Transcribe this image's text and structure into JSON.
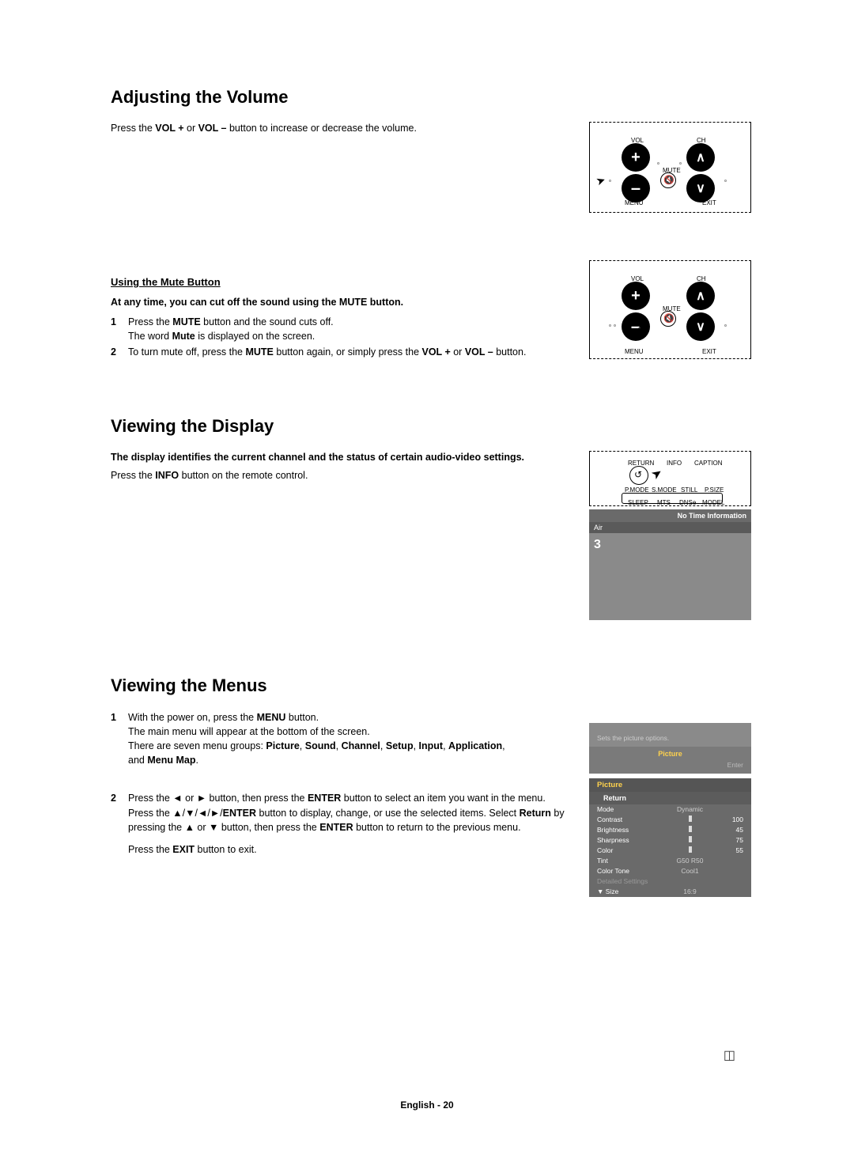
{
  "section1": {
    "heading": "Adjusting the Volume",
    "intro_a": "Press the ",
    "intro_b": "VOL +",
    "intro_c": " or ",
    "intro_d": "VOL –",
    "intro_e": " button to increase or decrease the volume.",
    "remote": {
      "vol": "VOL",
      "ch": "CH",
      "mute": "MUTE",
      "menu": "MENU",
      "exit": "EXIT",
      "plus": "+",
      "minus": "–"
    }
  },
  "mute": {
    "subhead": "Using the Mute Button",
    "lead": "At any time, you can cut off the sound using the MUTE button.",
    "step1_num": "1",
    "step1_a": "Press the ",
    "step1_b": "MUTE",
    "step1_c": " button and the sound cuts off.",
    "step1_line2_a": "The word ",
    "step1_line2_b": "Mute",
    "step1_line2_c": " is displayed on the screen.",
    "step2_num": "2",
    "step2_a": "To turn mute off, press the ",
    "step2_b": "MUTE",
    "step2_c": " button again, or simply press the ",
    "step2_d": "VOL +",
    "step2_e": " or ",
    "step2_f": "VOL –",
    "step2_g": " button.",
    "remote": {
      "vol": "VOL",
      "ch": "CH",
      "mute": "MUTE",
      "menu": "MENU",
      "exit": "EXIT"
    }
  },
  "section2": {
    "heading": "Viewing the Display",
    "lead": "The display identifies the current channel and the status of certain audio-video settings.",
    "body_a": "Press the ",
    "body_b": "INFO",
    "body_c": " button on the remote control.",
    "remote": {
      "return": "RETURN",
      "info": "INFO",
      "caption": "CAPTION",
      "pmode": "P.MODE",
      "smode": "S.MODE",
      "still": "STILL",
      "psize": "P.SIZE",
      "sleep": "SLEEP",
      "mts": "MTS",
      "dnse": "DNSe",
      "model": "MODEL"
    },
    "osd": {
      "title": "No Time Information",
      "source": "Air",
      "channel": "3"
    }
  },
  "section3": {
    "heading": "Viewing the Menus",
    "step1_num": "1",
    "step1_a": "With the power on, press the ",
    "step1_b": "MENU",
    "step1_c": " button.",
    "step1_line2": "The main menu will appear at the bottom of the screen.",
    "step1_line3_a": "There are seven menu groups: ",
    "step1_line3_b": "Picture",
    "step1_line3_c": ", ",
    "step1_line3_d": "Sound",
    "step1_line3_e": ", ",
    "step1_line3_f": "Channel",
    "step1_line3_g": ", ",
    "step1_line3_h": "Setup",
    "step1_line3_i": ", ",
    "step1_line3_j": "Input",
    "step1_line3_k": ", ",
    "step1_line3_l": "Application",
    "step1_line3_m": ",",
    "step1_line4_a": "and ",
    "step1_line4_b": "Menu Map",
    "step1_line4_c": ".",
    "step2_num": "2",
    "step2_a": "Press the ◄ or ► button, then press the ",
    "step2_b": "ENTER",
    "step2_c": " button to select an item you want in the menu. Press the ▲/▼/◄/►/",
    "step2_d": "ENTER",
    "step2_e": " button to display, change, or use the selected items. Select ",
    "step2_f": "Return",
    "step2_g": " by pressing the ▲ or ▼ button, then press the ",
    "step2_h": "ENTER",
    "step2_i": " button to return to the previous menu.",
    "step2_exit_a": "Press the ",
    "step2_exit_b": "EXIT",
    "step2_exit_c": " button to exit.",
    "menu": {
      "desc": "Sets the picture options.",
      "picture_menu": "Picture",
      "enter": "Enter",
      "section_title": "Picture",
      "return": "Return",
      "items": [
        {
          "k": "Mode",
          "m": "Dynamic",
          "v": ""
        },
        {
          "k": "Contrast",
          "m": "",
          "v": "100"
        },
        {
          "k": "Brightness",
          "m": "",
          "v": "45"
        },
        {
          "k": "Sharpness",
          "m": "",
          "v": "75"
        },
        {
          "k": "Color",
          "m": "",
          "v": "55"
        },
        {
          "k": "Tint",
          "m": "G50   R50",
          "v": ""
        },
        {
          "k": "Color Tone",
          "m": "Cool1",
          "v": ""
        },
        {
          "k": "Detailed Settings",
          "m": "",
          "v": ""
        },
        {
          "k": "▼ Size",
          "m": "16:9",
          "v": ""
        }
      ]
    }
  },
  "footer": {
    "text": "English - 20"
  }
}
